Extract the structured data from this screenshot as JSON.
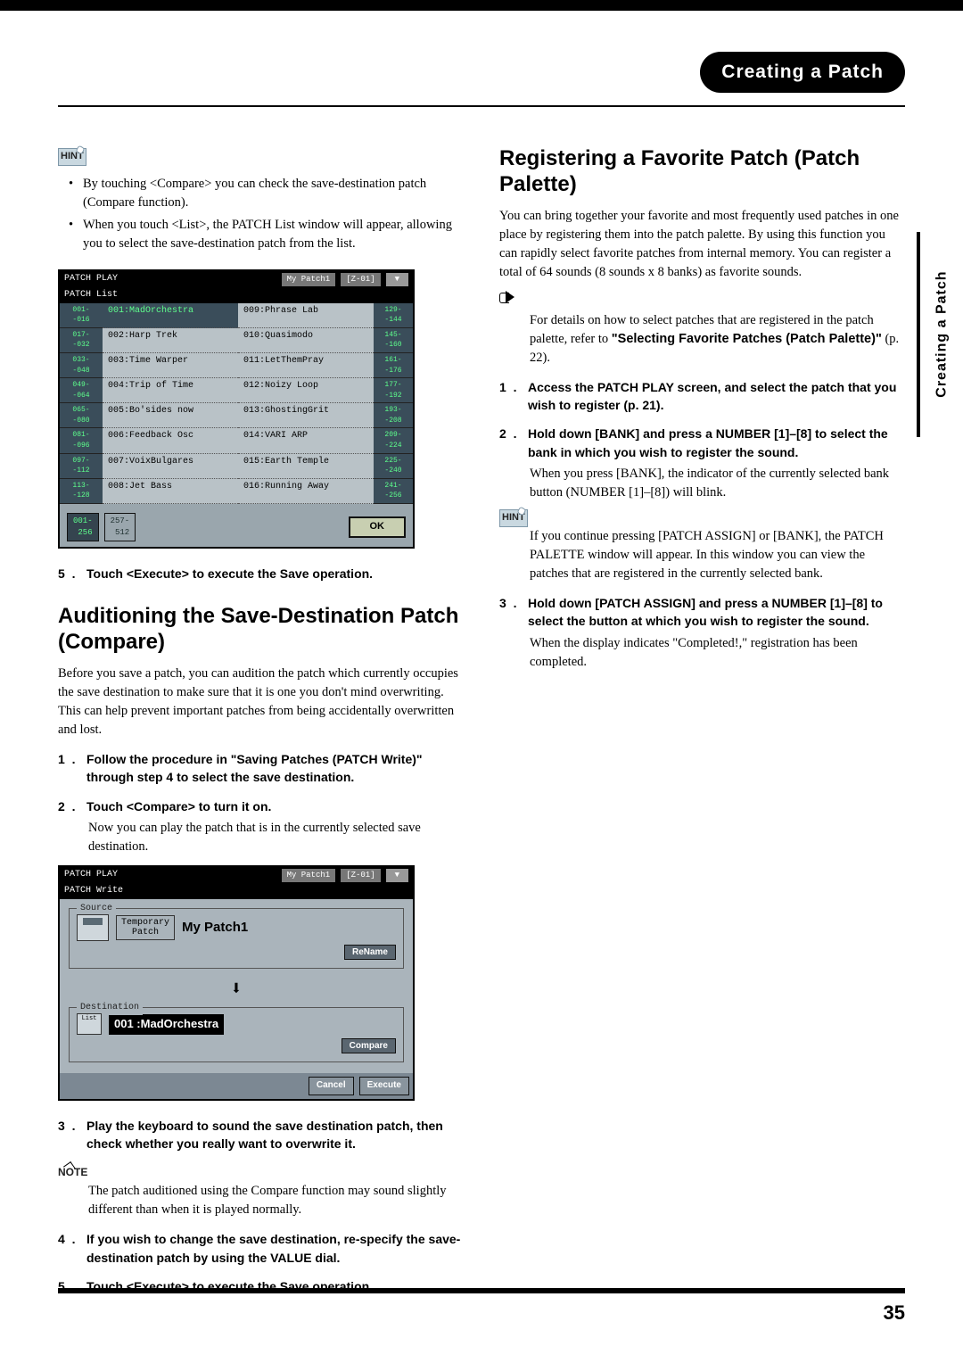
{
  "chapter_title": "Creating a Patch",
  "side_tab": "Creating a Patch",
  "page_number": "35",
  "labels": {
    "hint": "HINT",
    "note": "NOTE",
    "ok": "OK"
  },
  "left": {
    "hint_bullets": [
      "By touching <Compare> you can check the save-destination patch (Compare function).",
      "When you touch <List>, the PATCH List window will appear, allowing you to select the save-destination patch from the list."
    ],
    "fig1": {
      "bar_left": "PATCH PLAY",
      "bar_mid": "My Patch1",
      "bar_right": "[Z-01]",
      "bar_sub": "PATCH List",
      "left_ranges": [
        "001-\n-016",
        "017-\n-032",
        "033-\n-048",
        "049-\n-064",
        "065-\n-080",
        "081-\n-096",
        "097-\n-112",
        "113-\n-128"
      ],
      "right_ranges": [
        "129-\n-144",
        "145-\n-160",
        "161-\n-176",
        "177-\n-192",
        "193-\n-208",
        "209-\n-224",
        "225-\n-240",
        "241-\n-256"
      ],
      "colA": [
        "001:MadOrchestra",
        "002:Harp Trek",
        "003:Time Warper",
        "004:Trip of Time",
        "005:Bo'sides now",
        "006:Feedback Osc",
        "007:VoixBulgares",
        "008:Jet Bass"
      ],
      "colB": [
        "009:Phrase Lab",
        "010:Quasimodo",
        "011:LetThemPray",
        "012:Noizy Loop",
        "013:GhostingGrit",
        "014:VARI ARP",
        "015:Earth Temple",
        "016:Running Away"
      ],
      "foot_a": "001-\n 256",
      "foot_b": "257-\n 512"
    },
    "step5": {
      "num": "5 .",
      "text": "Touch <Execute> to execute the Save operation."
    },
    "h1": "Auditioning the Save-Destination Patch (Compare)",
    "intro": "Before you save a patch, you can audition the patch which currently occupies the save destination to make sure that it is one you don't mind overwriting. This can help prevent important patches from being accidentally overwritten and lost.",
    "step1": {
      "num": "1 .",
      "text": "Follow the procedure in \"Saving Patches (PATCH Write)\" through step 4 to select the save destination."
    },
    "step2": {
      "num": "2 .",
      "text": "Touch <Compare> to turn it on."
    },
    "step2_body": "Now you can play the patch that is in the currently selected save destination.",
    "fig2": {
      "bar_left": "PATCH PLAY",
      "bar_mid": "My Patch1",
      "bar_right": "[Z-01]",
      "bar_sub": "PATCH Write",
      "src_title": "Source",
      "temp": "Temporary\nPatch",
      "my": "My Patch1",
      "rename": "ReName",
      "dest_title": "Destination",
      "list": "List",
      "dest": "001 :MadOrchestra",
      "compare": "Compare",
      "cancel": "Cancel",
      "execute": "Execute"
    },
    "step3": {
      "num": "3 .",
      "text": "Play the keyboard to sound the save destination patch, then check whether you really want to overwrite it."
    },
    "note_body": "The patch auditioned using the Compare function may sound slightly different than when it is played normally.",
    "step4": {
      "num": "4 .",
      "text": "If you wish to change the save destination, re-specify the save-destination patch by using the VALUE dial."
    },
    "step5b": {
      "num": "5 .",
      "text": "Touch <Execute> to execute the Save operation."
    }
  },
  "right": {
    "h1": "Registering a Favorite Patch (Patch Palette)",
    "intro": "You can bring together your favorite and most frequently used patches in one place by registering them into the patch palette. By using this function you can rapidly select favorite patches from internal memory. You can register a total of 64 sounds (8 sounds x 8 banks) as favorite sounds.",
    "ref_body_a": "For details on how to select patches that are registered in the patch palette, refer to ",
    "ref_body_bold": "\"Selecting Favorite Patches (Patch Palette)\"",
    "ref_body_b": " (p. 22).",
    "step1": {
      "num": "1 .",
      "text": "Access the PATCH PLAY screen, and select the patch that you wish to register (p. 21)."
    },
    "step2": {
      "num": "2 .",
      "text": "Hold down [BANK] and press a NUMBER [1]–[8] to select the bank in which you wish to register the sound."
    },
    "step2_body": "When you press [BANK], the indicator of the currently selected bank button (NUMBER [1]–[8]) will blink.",
    "hint_body": "If you continue pressing [PATCH ASSIGN] or [BANK], the PATCH PALETTE window will appear. In this window you can view the patches that are registered in the currently selected bank.",
    "step3": {
      "num": "3 .",
      "text": "Hold down [PATCH ASSIGN] and press a NUMBER [1]–[8] to select the button at which you wish to register the sound."
    },
    "step3_body": "When the display indicates \"Completed!,\" registration has been completed."
  }
}
